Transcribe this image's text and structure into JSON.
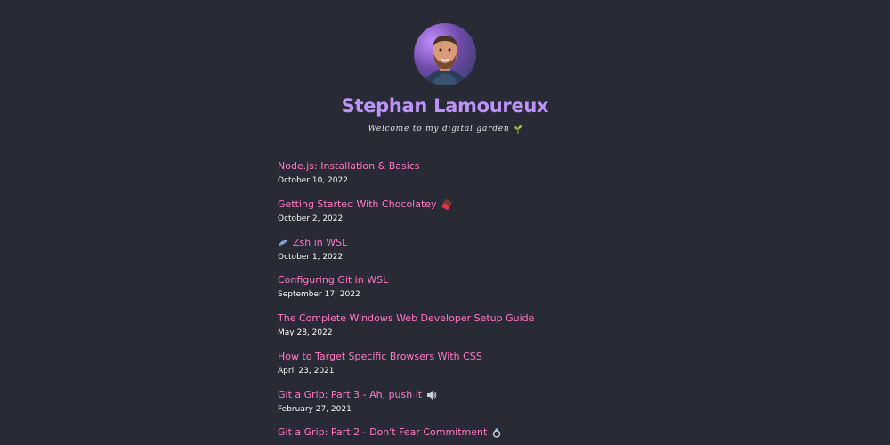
{
  "profile": {
    "name": "Stephan Lamoureux",
    "tagline": "Welcome to my digital garden",
    "tagline_icon": "sprout-icon",
    "avatar_icon": "avatar-photo"
  },
  "posts": [
    {
      "title": "Node.js: Installation & Basics",
      "date": "October 10, 2022",
      "icon": null
    },
    {
      "title": "Getting Started With Chocolatey",
      "date": "October 2, 2022",
      "icon": "chocolate-bar-icon"
    },
    {
      "title": "Zsh in WSL",
      "date": "October 1, 2022",
      "icon": "shell-icon"
    },
    {
      "title": "Configuring Git in WSL",
      "date": "September 17, 2022",
      "icon": null
    },
    {
      "title": "The Complete Windows Web Developer Setup Guide",
      "date": "May 28, 2022",
      "icon": null
    },
    {
      "title": "How to Target Specific Browsers With CSS",
      "date": "April 23, 2021",
      "icon": null
    },
    {
      "title": "Git a Grip: Part 3 - Ah, push it",
      "date": "February 27, 2021",
      "icon": "speaker-icon"
    },
    {
      "title": "Git a Grip: Part 2 - Don't Fear Commitment",
      "date": "",
      "icon": "ring-icon"
    }
  ],
  "colors": {
    "background": "#282a36",
    "title": "#bd93f9",
    "link": "#ff79c6",
    "text": "#f8f8f2"
  }
}
